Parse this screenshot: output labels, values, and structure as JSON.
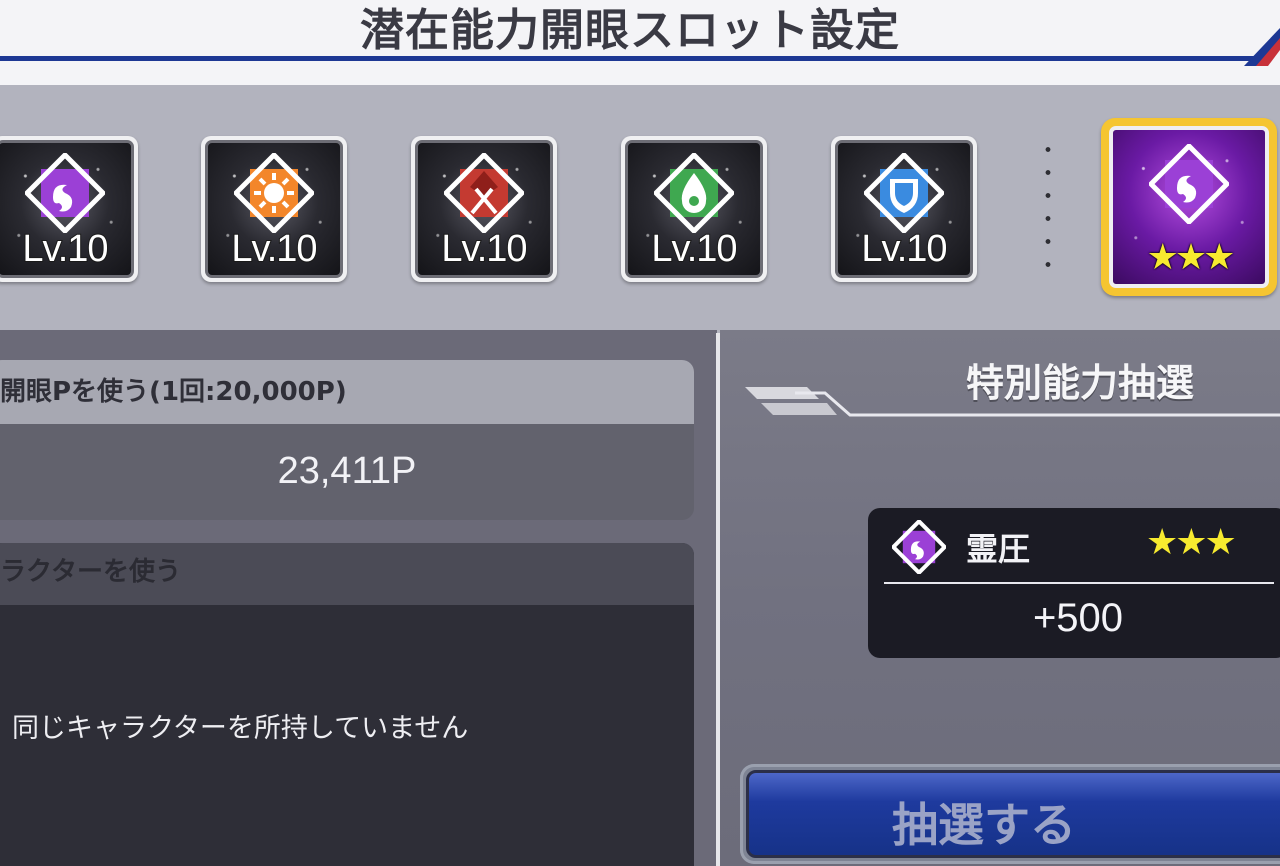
{
  "header": {
    "title": "潜在能力開眼スロット設定"
  },
  "slots": [
    {
      "id": "slot-1",
      "element": "spirit",
      "color": "#9b40d6",
      "level": "Lv.10"
    },
    {
      "id": "slot-2",
      "element": "fire",
      "color": "#f3862a",
      "level": "Lv.10"
    },
    {
      "id": "slot-3",
      "element": "crimson",
      "color": "#c43a31",
      "level": "Lv.10"
    },
    {
      "id": "slot-4",
      "element": "water-drop",
      "color": "#3fa850",
      "level": "Lv.10"
    },
    {
      "id": "slot-5",
      "element": "shield",
      "color": "#3a8be0",
      "level": "Lv.10"
    },
    {
      "id": "slot-special",
      "element": "spirit",
      "color": "#9b40d6",
      "stars": "★★★",
      "selected": true
    }
  ],
  "points_card": {
    "header": "開眼Pを使う(1回:20,000P)",
    "value": "23,411P"
  },
  "characters_card": {
    "header": "ラクターを使う",
    "message": "同じキャラクターを所持していません"
  },
  "special_panel": {
    "title": "特別能力抽選",
    "result": {
      "name": "霊圧",
      "stars": "★★★",
      "value": "+500"
    },
    "draw_button_label": "抽選する"
  },
  "colors": {
    "header_line": "#1d3894",
    "selected_frame": "#f5c531",
    "star": "#f7ea2f",
    "spirit_gem": "#9b40d6"
  }
}
